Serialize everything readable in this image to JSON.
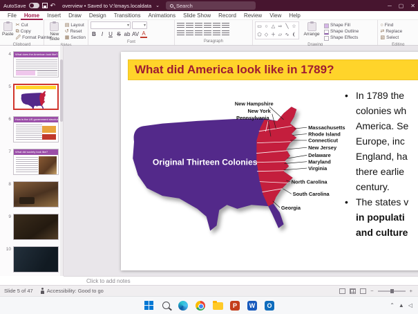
{
  "titlebar": {
    "autosave_label": "AutoSave",
    "document_title": "overview • Saved to V:\\tmays.localdata",
    "search_placeholder": "Search"
  },
  "menubar": {
    "items": [
      "File",
      "Home",
      "Insert",
      "Draw",
      "Design",
      "Transitions",
      "Animations",
      "Slide Show",
      "Record",
      "Review",
      "View",
      "Help"
    ],
    "active_item": "Home"
  },
  "ribbon": {
    "clipboard": {
      "label": "Clipboard",
      "paste": "Paste",
      "cut": "Cut",
      "copy": "Copy",
      "format_painter": "Format Painter"
    },
    "slides": {
      "label": "Slides",
      "new_slide": "New Slide",
      "layout": "Layout",
      "reset": "Reset",
      "section": "Section"
    },
    "font": {
      "label": "Font"
    },
    "paragraph": {
      "label": "Paragraph"
    },
    "drawing": {
      "label": "Drawing",
      "arrange": "Arrange",
      "shape_fill": "Shape Fill",
      "shape_outline": "Shape Outline",
      "shape_effects": "Shape Effects"
    },
    "editing": {
      "label": "Editing",
      "find": "Find",
      "replace": "Replace",
      "select": "Select"
    }
  },
  "sidebar": {
    "thumbnails": [
      {
        "number": "4",
        "title": "What does the American look like?"
      },
      {
        "number": "5",
        "title": "What did America look like in 1789?"
      },
      {
        "number": "6",
        "title": "How is the US government structured?"
      },
      {
        "number": "7",
        "title": "What did society look like?"
      },
      {
        "number": "8",
        "title": ""
      },
      {
        "number": "9",
        "title": ""
      },
      {
        "number": "10",
        "title": ""
      }
    ]
  },
  "slide": {
    "title": "What did America look like in 1789?",
    "map_caption": "Original Thirteen Colonies",
    "colonies": [
      "New Hampshire",
      "New York",
      "Pennsylvania",
      "Massachusetts",
      "Rhode Island",
      "Connecticut",
      "New Jersey",
      "Delaware",
      "Maryland",
      "Virginia",
      "North Carolina",
      "South Carolina",
      "Georgia"
    ],
    "bullets": {
      "b1": [
        "In 1789 the",
        "colonies wh",
        "America. Se",
        "Europe, inc",
        "England, ha",
        "there earlie",
        "century."
      ],
      "b2_regular": "The states v",
      "b2_bold1": "in populati",
      "b2_bold2": "and culture"
    }
  },
  "notes_placeholder": "Click to add notes",
  "statusbar": {
    "slide_indicator": "Slide 5 of 47",
    "accessibility": "Accessibility: Good to go"
  },
  "colors": {
    "map_purple": "#53298a",
    "colony_red": "#c41e3d",
    "title_red": "#9e1b32",
    "highlight_yellow": "#ffd42a",
    "titlebar_maroon": "#47152f"
  }
}
